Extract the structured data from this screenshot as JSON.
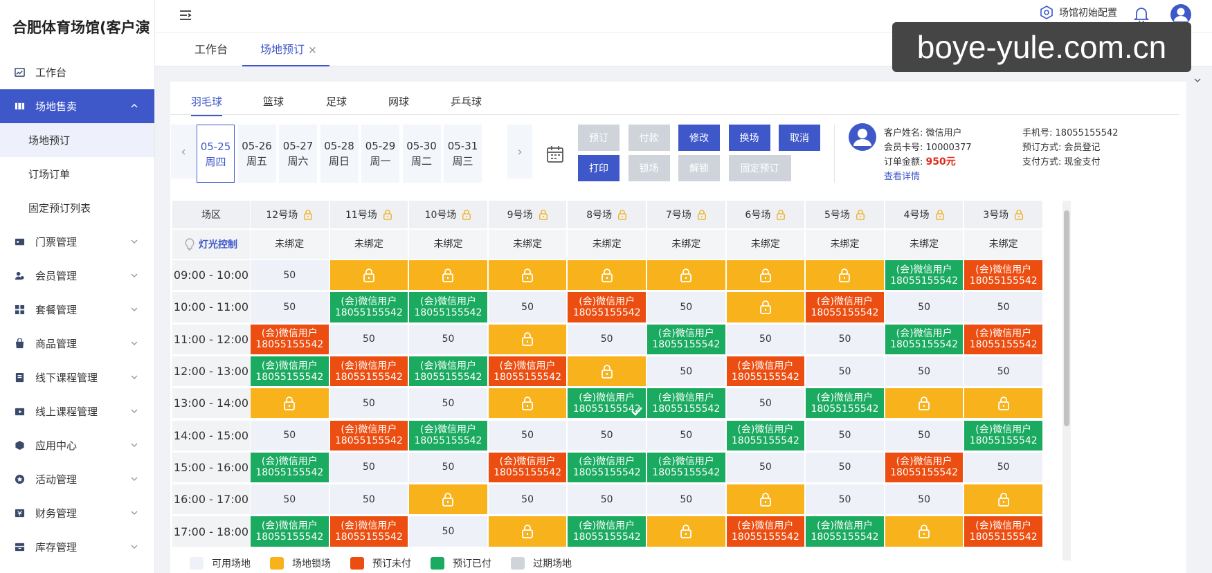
{
  "brand": "合肥体育场馆(客户演",
  "menu": [
    {
      "label": "工作台",
      "icon": "dashboard-icon"
    },
    {
      "label": "场地售卖",
      "icon": "venue-sale-icon",
      "active": true
    },
    {
      "label": "门票管理",
      "icon": "ticket-icon"
    },
    {
      "label": "会员管理",
      "icon": "member-icon"
    },
    {
      "label": "套餐管理",
      "icon": "package-icon"
    },
    {
      "label": "商品管理",
      "icon": "goods-icon"
    },
    {
      "label": "线下课程管理",
      "icon": "offline-course-icon"
    },
    {
      "label": "线上课程管理",
      "icon": "online-course-icon"
    },
    {
      "label": "应用中心",
      "icon": "app-center-icon"
    },
    {
      "label": "活动管理",
      "icon": "activity-icon"
    },
    {
      "label": "财务管理",
      "icon": "finance-icon"
    },
    {
      "label": "库存管理",
      "icon": "inventory-icon"
    }
  ],
  "submenu": [
    "场地预订",
    "订场订单",
    "固定预订列表"
  ],
  "topbar": {
    "config_label": "场馆初始配置"
  },
  "tabs": [
    "工作台",
    "场地预订"
  ],
  "watermark": "boye-yule.com.cn",
  "sport_tabs": [
    "羽毛球",
    "篮球",
    "足球",
    "网球",
    "乒乓球"
  ],
  "dates": [
    {
      "date": "05-25",
      "weekday": "周四"
    },
    {
      "date": "05-26",
      "weekday": "周五"
    },
    {
      "date": "05-27",
      "weekday": "周六"
    },
    {
      "date": "05-28",
      "weekday": "周日"
    },
    {
      "date": "05-29",
      "weekday": "周一"
    },
    {
      "date": "05-30",
      "weekday": "周二"
    },
    {
      "date": "05-31",
      "weekday": "周三"
    }
  ],
  "nav": {
    "prev": "‹",
    "next": "›"
  },
  "actions": {
    "row1": [
      {
        "label": "预订",
        "style": "grey"
      },
      {
        "label": "付款",
        "style": "grey"
      },
      {
        "label": "修改",
        "style": "blue"
      },
      {
        "label": "换场",
        "style": "blue"
      },
      {
        "label": "取消",
        "style": "blue"
      }
    ],
    "row2": [
      {
        "label": "打印",
        "style": "blue"
      },
      {
        "label": "锁场",
        "style": "grey"
      },
      {
        "label": "解锁",
        "style": "grey"
      },
      {
        "label": "固定预订",
        "style": "grey"
      }
    ]
  },
  "customer": {
    "name_label": "客户姓名:",
    "name": "微信用户",
    "card_label": "会员卡号:",
    "card": "10000377",
    "amount_label": "订单金额:",
    "amount": "950元",
    "phone_label": "手机号:",
    "phone": "18055155542",
    "way_label": "预订方式:",
    "way": "会员登记",
    "pay_label": "支付方式:",
    "pay": "现金支付",
    "detail_link": "查看详情"
  },
  "grid": {
    "corner": "场区",
    "light_label": "灯光控制",
    "bind_text": "未绑定",
    "courts": [
      "12号场",
      "11号场",
      "10号场",
      "9号场",
      "8号场",
      "7号场",
      "6号场",
      "5号场",
      "4号场",
      "3号场"
    ],
    "booking_line1": "(会)微信用户",
    "booking_line2": "18055155542",
    "price": "50",
    "rows": [
      {
        "time": "09:00 - 10:00",
        "cells": [
          "F",
          "L",
          "L",
          "L",
          "L",
          "L",
          "L",
          "L",
          "P",
          "U"
        ]
      },
      {
        "time": "10:00 - 11:00",
        "cells": [
          "F",
          "P",
          "P",
          "F",
          "U",
          "F",
          "L",
          "U",
          "F",
          "F"
        ]
      },
      {
        "time": "11:00 - 12:00",
        "cells": [
          "U",
          "F",
          "F",
          "L",
          "F",
          "P",
          "F",
          "F",
          "P",
          "U"
        ]
      },
      {
        "time": "12:00 - 13:00",
        "cells": [
          "P",
          "U",
          "P",
          "U",
          "L",
          "F",
          "U",
          "F",
          "F",
          "F"
        ]
      },
      {
        "time": "13:00 - 14:00",
        "cells": [
          "L",
          "F",
          "F",
          "L",
          "PC",
          "P",
          "F",
          "P",
          "L",
          "L"
        ]
      },
      {
        "time": "14:00 - 15:00",
        "cells": [
          "F",
          "U",
          "P",
          "F",
          "F",
          "F",
          "P",
          "F",
          "F",
          "P"
        ]
      },
      {
        "time": "15:00 - 16:00",
        "cells": [
          "P",
          "F",
          "F",
          "U",
          "P",
          "P",
          "F",
          "F",
          "U",
          "F"
        ]
      },
      {
        "time": "16:00 - 17:00",
        "cells": [
          "F",
          "F",
          "L",
          "F",
          "F",
          "F",
          "L",
          "F",
          "F",
          "L"
        ]
      },
      {
        "time": "17:00 - 18:00",
        "cells": [
          "P",
          "U",
          "F",
          "L",
          "P",
          "L",
          "U",
          "P",
          "L",
          "U"
        ]
      }
    ]
  },
  "legend": [
    {
      "label": "可用场地",
      "color": "#eef2f8"
    },
    {
      "label": "场地锁场",
      "color": "#f8b21c"
    },
    {
      "label": "预订未付",
      "color": "#ec4d10"
    },
    {
      "label": "预订已付",
      "color": "#1aaa60"
    },
    {
      "label": "过期场地",
      "color": "#cfd3da"
    }
  ]
}
